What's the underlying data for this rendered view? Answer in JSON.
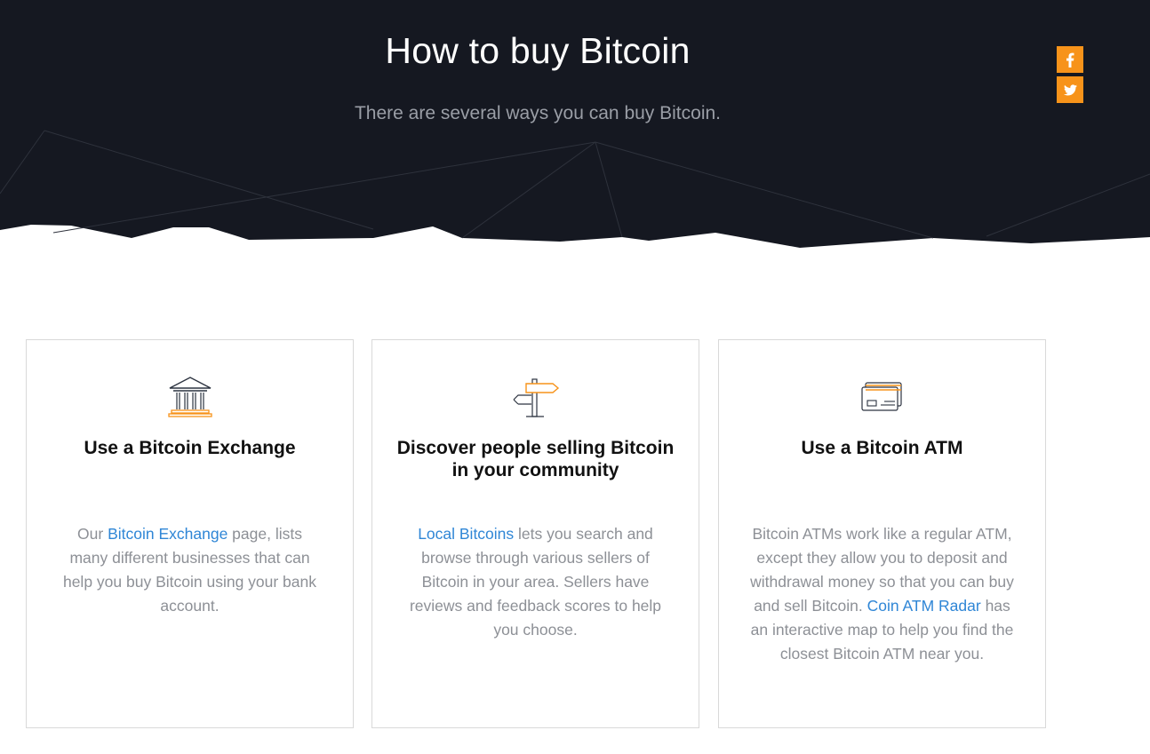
{
  "hero": {
    "title": "How to buy Bitcoin",
    "subtitle": "There are several ways you can buy Bitcoin."
  },
  "social": {
    "facebook_icon": "facebook-icon",
    "twitter_icon": "twitter-icon"
  },
  "colors": {
    "hero_bg": "#151821",
    "accent": "#f7931a",
    "link": "#2f86d6",
    "body_text": "#8d9096"
  },
  "cards": [
    {
      "icon": "bank-icon",
      "title": "Use a Bitcoin Exchange",
      "text_before": "Our ",
      "link": "Bitcoin Exchange",
      "text_after": " page, lists many different businesses that can help you buy Bitcoin using your bank account."
    },
    {
      "icon": "signpost-icon",
      "title": "Discover people selling Bitcoin in your community",
      "text_before": "",
      "link": "Local Bitcoins",
      "text_after": " lets you search and browse through various sellers of Bitcoin in your area. Sellers have reviews and feedback scores to help you choose."
    },
    {
      "icon": "card-icon",
      "title": "Use a Bitcoin ATM",
      "text_before": "Bitcoin ATMs work like a regular ATM, except they allow you to deposit and withdrawal money so that you can buy and sell Bitcoin. ",
      "link": "Coin ATM Radar",
      "text_after": " has an interactive map to help you find the closest Bitcoin ATM near you."
    }
  ]
}
